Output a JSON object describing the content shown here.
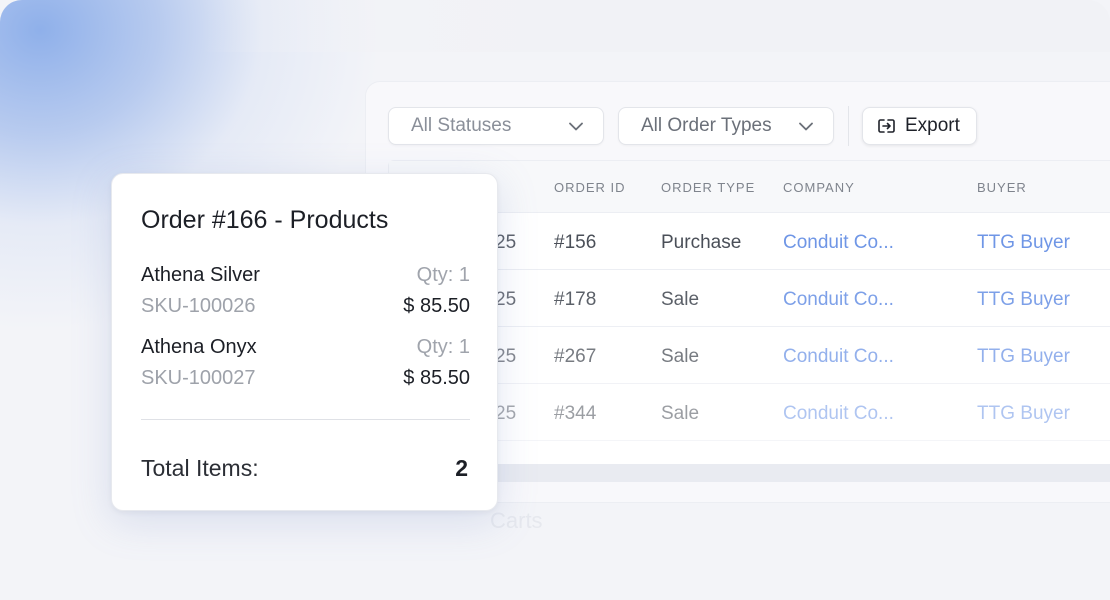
{
  "toolbar": {
    "status_filter": "All Statuses",
    "order_type_filter": "All Order Types",
    "export_label": "Export"
  },
  "table": {
    "columns": [
      "ORDER ID",
      "ORDER TYPE",
      "COMPANY",
      "BUYER"
    ],
    "rows": [
      {
        "date": "25",
        "order_id": "#156",
        "order_type": "Purchase",
        "company": "Conduit Co...",
        "buyer": "TTG Buyer"
      },
      {
        "date": "25",
        "order_id": "#178",
        "order_type": "Sale",
        "company": "Conduit Co...",
        "buyer": "TTG Buyer"
      },
      {
        "date": "25",
        "order_id": "#267",
        "order_type": "Sale",
        "company": "Conduit Co...",
        "buyer": "TTG Buyer"
      },
      {
        "date": "25",
        "order_id": "#344",
        "order_type": "Sale",
        "company": "Conduit Co...",
        "buyer": "TTG Buyer"
      }
    ]
  },
  "background_section": "Carts",
  "order_card": {
    "title": "Order #166 - Products",
    "items": [
      {
        "name": "Athena Silver",
        "qty": "Qty: 1",
        "sku": "SKU-100026",
        "price": "$ 85.50"
      },
      {
        "name": "Athena Onyx",
        "qty": "Qty: 1",
        "sku": "SKU-100027",
        "price": "$ 85.50"
      }
    ],
    "total_label": "Total Items:",
    "total_value": "2"
  },
  "colors": {
    "link": "#6f96e6",
    "accent_glow": "#8fb0ea"
  }
}
